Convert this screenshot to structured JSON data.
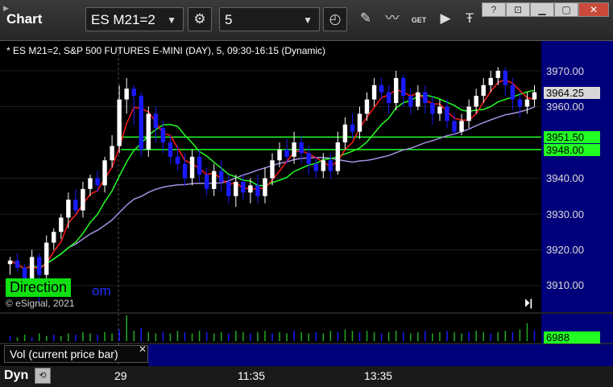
{
  "toolbar": {
    "title": "Chart",
    "symbol": "ES M21=2",
    "interval": "5",
    "get_label": "GET"
  },
  "chart": {
    "title": "* ES M21=2, S&P 500 FUTURES E-MINI (DAY), 5, 09:30-16:15 (Dynamic)",
    "copyright": "© eSignal, 2021",
    "direction_label": "Direction",
    "direction_tail": "om",
    "scroll_end": "⏵|",
    "price_ticks": [
      "3970.00",
      "3960.00",
      "3940.00",
      "3930.00",
      "3920.00",
      "3910.00"
    ],
    "last_price": "3964.25",
    "level_upper": "3951.50",
    "level_lower": "3948.00"
  },
  "volume": {
    "label": "Vol (current price bar)",
    "value": "6988"
  },
  "time_axis": {
    "dyn_label": "Dyn",
    "labels": [
      "29",
      "11:35",
      "13:35"
    ]
  },
  "colors": {
    "background": "#000000",
    "up_candle": "#ffffff",
    "down_candle": "#1a1aff",
    "red_ma": "#ff1a1a",
    "green_ma": "#22ff22",
    "purple_ma": "#a68fe0",
    "accent_green": "#10e010",
    "blue_pane": "#00007a"
  },
  "chart_data": {
    "type": "candlestick",
    "ylim": [
      3902,
      3978
    ],
    "yticks": [
      3910,
      3920,
      3930,
      3940,
      3960,
      3970
    ],
    "levels": [
      3951.5,
      3948.0
    ],
    "last": 3964.25,
    "candles": [
      [
        3916,
        3917,
        3913,
        3918
      ],
      [
        3917,
        3915,
        3914,
        3919
      ],
      [
        3915,
        3912,
        3910,
        3916
      ],
      [
        3912,
        3918,
        3911,
        3920
      ],
      [
        3918,
        3913,
        3905,
        3919
      ],
      [
        3913,
        3922,
        3912,
        3924
      ],
      [
        3922,
        3925,
        3920,
        3926
      ],
      [
        3925,
        3929,
        3923,
        3930
      ],
      [
        3929,
        3934,
        3926,
        3936
      ],
      [
        3934,
        3931,
        3930,
        3937
      ],
      [
        3931,
        3937,
        3929,
        3939
      ],
      [
        3937,
        3940,
        3935,
        3941
      ],
      [
        3940,
        3938,
        3936,
        3942
      ],
      [
        3938,
        3945,
        3936,
        3946
      ],
      [
        3945,
        3949,
        3943,
        3952
      ],
      [
        3949,
        3962,
        3947,
        3966
      ],
      [
        3962,
        3965,
        3958,
        3968
      ],
      [
        3965,
        3963,
        3955,
        3966
      ],
      [
        3963,
        3948,
        3946,
        3964
      ],
      [
        3948,
        3958,
        3946,
        3960
      ],
      [
        3958,
        3954,
        3950,
        3960
      ],
      [
        3954,
        3950,
        3947,
        3956
      ],
      [
        3950,
        3946,
        3944,
        3952
      ],
      [
        3946,
        3944,
        3942,
        3949
      ],
      [
        3944,
        3940,
        3938,
        3947
      ],
      [
        3940,
        3946,
        3938,
        3948
      ],
      [
        3946,
        3941,
        3939,
        3948
      ],
      [
        3941,
        3937,
        3935,
        3943
      ],
      [
        3937,
        3942,
        3935,
        3944
      ],
      [
        3942,
        3939,
        3936,
        3945
      ],
      [
        3939,
        3935,
        3933,
        3941
      ],
      [
        3935,
        3939,
        3932,
        3941
      ],
      [
        3939,
        3936,
        3934,
        3941
      ],
      [
        3936,
        3938,
        3933,
        3940
      ],
      [
        3938,
        3935,
        3933,
        3941
      ],
      [
        3935,
        3940,
        3933,
        3943
      ],
      [
        3940,
        3945,
        3938,
        3947
      ],
      [
        3945,
        3948,
        3943,
        3950
      ],
      [
        3948,
        3946,
        3944,
        3951
      ],
      [
        3946,
        3950,
        3944,
        3953
      ],
      [
        3950,
        3947,
        3944,
        3952
      ],
      [
        3947,
        3944,
        3941,
        3949
      ],
      [
        3944,
        3942,
        3940,
        3946
      ],
      [
        3942,
        3945,
        3940,
        3947
      ],
      [
        3945,
        3942,
        3940,
        3947
      ],
      [
        3942,
        3950,
        3941,
        3953
      ],
      [
        3950,
        3955,
        3948,
        3957
      ],
      [
        3955,
        3953,
        3951,
        3958
      ],
      [
        3953,
        3958,
        3951,
        3960
      ],
      [
        3958,
        3962,
        3956,
        3964
      ],
      [
        3962,
        3966,
        3960,
        3968
      ],
      [
        3966,
        3964,
        3962,
        3968
      ],
      [
        3964,
        3961,
        3958,
        3966
      ],
      [
        3961,
        3968,
        3959,
        3970
      ],
      [
        3968,
        3963,
        3960,
        3969
      ],
      [
        3963,
        3960,
        3958,
        3965
      ],
      [
        3960,
        3964,
        3959,
        3966
      ],
      [
        3964,
        3961,
        3958,
        3966
      ],
      [
        3961,
        3958,
        3955,
        3963
      ],
      [
        3958,
        3960,
        3956,
        3962
      ],
      [
        3960,
        3956,
        3954,
        3962
      ],
      [
        3956,
        3953,
        3952,
        3958
      ],
      [
        3953,
        3956,
        3952,
        3958
      ],
      [
        3956,
        3960,
        3954,
        3962
      ],
      [
        3960,
        3963,
        3958,
        3965
      ],
      [
        3963,
        3966,
        3961,
        3968
      ],
      [
        3966,
        3968,
        3964,
        3970
      ],
      [
        3968,
        3970,
        3966,
        3971
      ],
      [
        3970,
        3966,
        3963,
        3971
      ],
      [
        3966,
        3962,
        3959,
        3968
      ],
      [
        3962,
        3960,
        3957,
        3964
      ],
      [
        3960,
        3962,
        3958,
        3964
      ],
      [
        3962,
        3964,
        3960,
        3966
      ]
    ],
    "volume": [
      4,
      3,
      5,
      3,
      6,
      4,
      5,
      4,
      6,
      5,
      7,
      6,
      5,
      7,
      6,
      9,
      20,
      8,
      10,
      7,
      6,
      7,
      6,
      8,
      7,
      6,
      8,
      7,
      6,
      7,
      6,
      8,
      7,
      6,
      7,
      8,
      6,
      7,
      6,
      8,
      7,
      6,
      7,
      6,
      8,
      7,
      9,
      8,
      7,
      8,
      7,
      6,
      7,
      8,
      7,
      6,
      7,
      8,
      6,
      7,
      8,
      7,
      6,
      7,
      8,
      7,
      6,
      7,
      8,
      7,
      9,
      14,
      8
    ]
  }
}
